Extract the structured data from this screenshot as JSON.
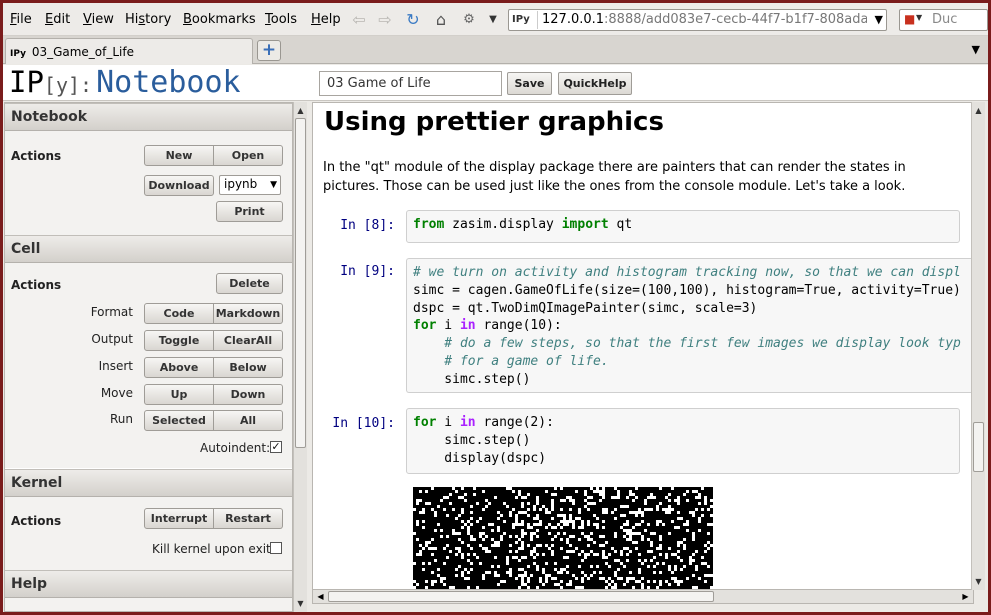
{
  "browser": {
    "menus": [
      {
        "key": "F",
        "rest": "ile"
      },
      {
        "key": "E",
        "rest": "dit"
      },
      {
        "key": "V",
        "rest": "iew"
      },
      {
        "key": "",
        "pre": "Hi",
        "keymid": "s",
        "rest": "tory"
      },
      {
        "key": "B",
        "rest": "ookmarks"
      },
      {
        "key": "T",
        "rest": "ools"
      },
      {
        "key": "H",
        "rest": "elp"
      }
    ],
    "url_host": "127.0.0.1",
    "url_rest": ":8888/add083e7-cecb-44f7-b1f7-808ada",
    "url_badge": "IPy",
    "search_placeholder": "Duc",
    "tab_title": "03_Game_of_Life",
    "tab_badge": "IPy"
  },
  "header": {
    "logo_ip": "IP",
    "logo_y": "[y]:",
    "logo_notebook": "Notebook",
    "notebook_name": "03  Game  of  Life",
    "save_label": "Save",
    "quickhelp_label": "QuickHelp"
  },
  "panel": {
    "notebook": {
      "title": "Notebook",
      "actions_label": "Actions",
      "new": "New",
      "open": "Open",
      "download": "Download",
      "format_value": "ipynb",
      "print": "Print"
    },
    "cell": {
      "title": "Cell",
      "actions_label": "Actions",
      "delete": "Delete",
      "format_label": "Format",
      "code": "Code",
      "markdown": "Markdown",
      "output_label": "Output",
      "toggle": "Toggle",
      "clearall": "ClearAll",
      "insert_label": "Insert",
      "above": "Above",
      "below": "Below",
      "move_label": "Move",
      "up": "Up",
      "down": "Down",
      "run_label": "Run",
      "selected": "Selected",
      "all": "All",
      "autoindent_label": "Autoindent:",
      "autoindent_checked": true
    },
    "kernel": {
      "title": "Kernel",
      "actions_label": "Actions",
      "interrupt": "Interrupt",
      "restart": "Restart",
      "kill_label": "Kill kernel upon exit:",
      "kill_checked": false
    },
    "help": {
      "title": "Help"
    }
  },
  "notebook": {
    "heading": "Using prettier graphics",
    "paragraph": "In the \"qt\" module of the display package there are painters that can render the states in pictures. Those can be used just like the ones from the console module. Let's take a look.",
    "cells": [
      {
        "prompt": "In [8]:"
      },
      {
        "prompt": "In [9]:"
      },
      {
        "prompt": "In [10]:"
      }
    ],
    "code8": {
      "kw1": "from",
      "mod": " zasim.display ",
      "kw2": "import",
      "name": " qt"
    },
    "code9": {
      "line1": "# we turn on activity and histogram tracking now, so that we can displ",
      "line2": "simc = cagen.GameOfLife(size=(100,100), histogram=True, activity=True)",
      "line3": "dspc = qt.TwoDimQImagePainter(simc, scale=3)",
      "line4_kw": "for",
      "line4_i": " i ",
      "line4_in": "in",
      "line4_rest": " range(10):",
      "line5": "    # do a few steps, so that the first few images we display look typ",
      "line6": "    # for a game of life.",
      "line7": "    simc.step()"
    },
    "code10": {
      "line1_kw": "for",
      "line1_i": " i ",
      "line1_in": "in",
      "line1_rest": " range(2):",
      "line2": "    simc.step()",
      "line3": "    display(dspc)"
    }
  }
}
